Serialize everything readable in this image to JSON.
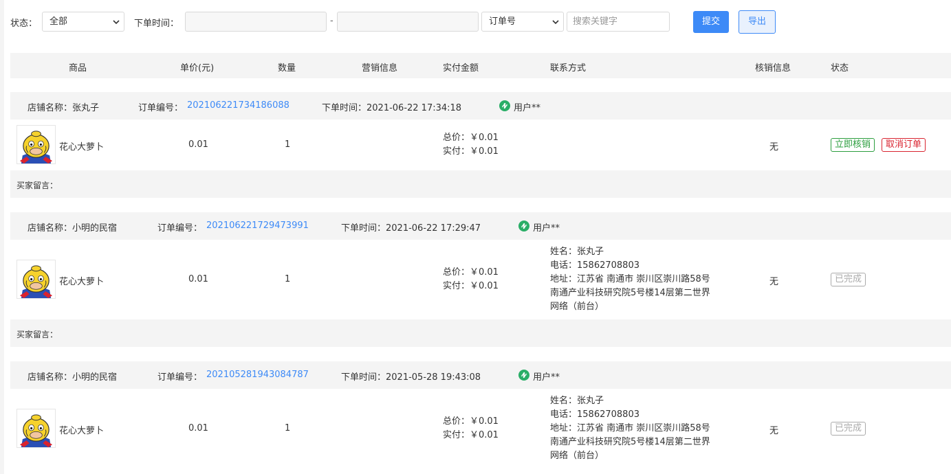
{
  "filter": {
    "status_label": "状态：",
    "status_value": "全部",
    "time_label": "下单时间：",
    "date_separator": "-",
    "field_value": "订单号",
    "search_placeholder": "搜索关键字",
    "submit_label": "提交",
    "export_label": "导出"
  },
  "table_headers": [
    "商品",
    "单价(元)",
    "数量",
    "营销信息",
    "实付金额",
    "联系方式",
    "核销信息",
    "状态"
  ],
  "orders": [
    {
      "shop": "店铺名称：张丸子",
      "order_no_label": "订单编号：",
      "order_no": "202106221734186088",
      "order_time": "下单时间：2021-06-22 17:34:18",
      "user": "用户**",
      "product": "花心大萝卜",
      "price": "0.01",
      "qty": "1",
      "total": "总价：￥0.01",
      "paid": "实付：￥0.01",
      "contact_name": "",
      "contact_phone": "",
      "contact_address": "",
      "verify": "无",
      "actions": [
        "立即核销",
        "取消订单"
      ],
      "message": "买家留言："
    },
    {
      "shop": "店铺名称：小明的民宿",
      "order_no_label": "订单编号：",
      "order_no": "202106221729473991",
      "order_time": "下单时间：2021-06-22 17:29:47",
      "user": "用户**",
      "product": "花心大萝卜",
      "price": "0.01",
      "qty": "1",
      "total": "总价：￥0.01",
      "paid": "实付：￥0.01",
      "contact_name": "姓名：张丸子",
      "contact_phone": "电话：15862708803",
      "contact_address": "地址：江苏省 南通市 崇川区崇川路58号南通产业科技研究院5号楼14层第二世界网络（前台）",
      "verify": "无",
      "status": "已完成",
      "message": "买家留言："
    },
    {
      "shop": "店铺名称：小明的民宿",
      "order_no_label": "订单编号：",
      "order_no": "202105281943084787",
      "order_time": "下单时间：2021-05-28 19:43:08",
      "user": "用户**",
      "product": "花心大萝卜",
      "price": "0.01",
      "qty": "1",
      "total": "总价：￥0.01",
      "paid": "实付：￥0.01",
      "contact_name": "姓名：张丸子",
      "contact_phone": "电话：15862708803",
      "contact_address": "地址：江苏省 南通市 崇川区崇川路58号南通产业科技研究院5号楼14层第二世界网络（前台）",
      "verify": "无",
      "status": "已完成"
    }
  ],
  "colors": {
    "primary": "#3d8af7",
    "green": "#2a9d3d",
    "red": "#d9232f",
    "row_bg": "#f4f4f4"
  },
  "icons": {
    "wechat": "wechat-mini-program-icon",
    "product": "yellow-duck-avatar"
  }
}
